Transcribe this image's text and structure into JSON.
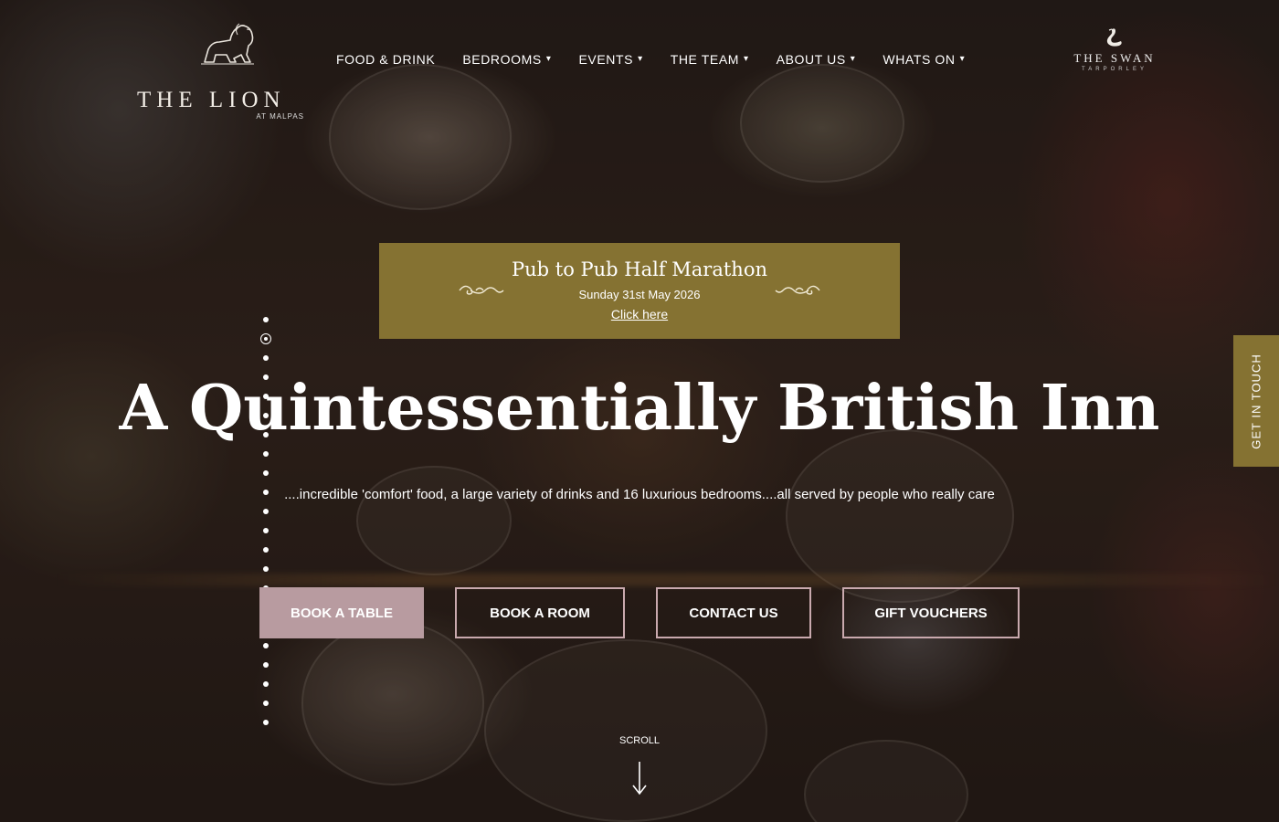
{
  "header": {
    "left_logo": {
      "name": "THE LION",
      "sub": "AT MALPAS"
    },
    "nav": [
      {
        "label": "FOOD & DRINK",
        "has_dropdown": false
      },
      {
        "label": "BEDROOMS",
        "has_dropdown": true
      },
      {
        "label": "EVENTS",
        "has_dropdown": true
      },
      {
        "label": "THE TEAM",
        "has_dropdown": true
      },
      {
        "label": "ABOUT US",
        "has_dropdown": true
      },
      {
        "label": "WHATS ON",
        "has_dropdown": true
      }
    ],
    "right_logo": {
      "name": "THE SWAN",
      "sub": "TARPORLEY"
    },
    "dropdown_caret": "▾"
  },
  "event_banner": {
    "title": "Pub to Pub Half Marathon",
    "date": "Sunday 31st May 2026",
    "link": "Click here"
  },
  "hero": {
    "title": "A Quintessentially British Inn",
    "subtitle": "....incredible 'comfort' food, a large variety of drinks and 16 luxurious bedrooms....all served by people who really care"
  },
  "cta_buttons": [
    {
      "label": "BOOK A TABLE",
      "style": "filled"
    },
    {
      "label": "BOOK A ROOM",
      "style": "outline"
    },
    {
      "label": "CONTACT US",
      "style": "outline"
    },
    {
      "label": "GIFT VOUCHERS",
      "style": "outline"
    }
  ],
  "side_tab": {
    "label": "GET IN TOUCH"
  },
  "scroll": {
    "label": "SCROLL"
  },
  "dot_nav": {
    "count": 22,
    "active_index": 1
  },
  "colors": {
    "gold": "#857232",
    "button_pink": "#b89ba0",
    "button_border": "#c9a9ae",
    "text": "#ffffff"
  }
}
